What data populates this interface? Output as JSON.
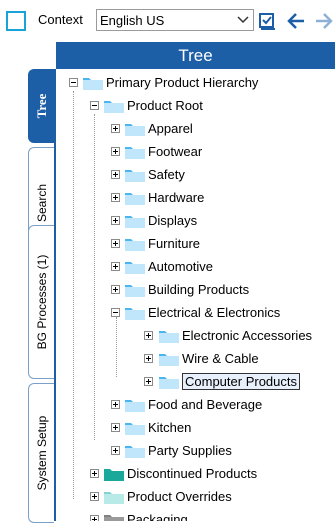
{
  "toolbar": {
    "context_label": "Context",
    "context_value": "English US",
    "icons": [
      "checkbox-icon",
      "chevron-down-icon",
      "edit-check-icon",
      "back-arrow-icon",
      "forward-arrow-icon"
    ]
  },
  "panel": {
    "title": "Tree"
  },
  "sidebar": {
    "tabs": [
      {
        "label": "Tree",
        "active": true
      },
      {
        "label": "Search",
        "active": false
      },
      {
        "label": "BG Processes (1)",
        "active": false
      },
      {
        "label": "System Setup",
        "active": false
      }
    ]
  },
  "tree": {
    "root": "Primary Product Hierarchy",
    "product_root": "Product Root",
    "children": [
      "Apparel",
      "Footwear",
      "Safety",
      "Hardware",
      "Displays",
      "Furniture",
      "Automotive",
      "Building Products",
      "Electrical & Electronics"
    ],
    "electrical_children": [
      "Electronic Accessories",
      "Wire & Cable",
      "Computer Products"
    ],
    "after_electrical": [
      "Food and Beverage",
      "Kitchen",
      "Party Supplies"
    ],
    "siblings": [
      "Discontinued Products",
      "Product Overrides",
      "Packaging"
    ],
    "selected": "Computer Products"
  },
  "colors": {
    "accent": "#1c5fa6",
    "folder_blue": "#49b6f0",
    "folder_teal": "#1aa89a",
    "folder_light_teal": "#7fd4d0",
    "folder_gray": "#808080"
  }
}
